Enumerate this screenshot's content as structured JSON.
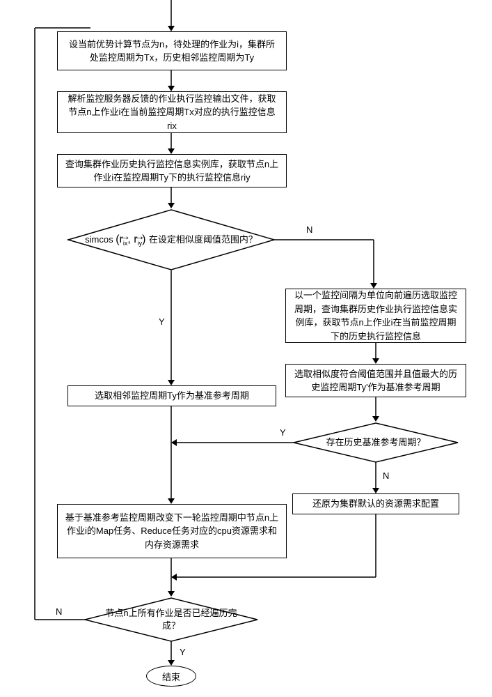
{
  "boxes": {
    "b1": "设当前优势计算节点为n，待处理的作业为i，集群所处监控周期为Tx，历史相邻监控周期为Ty",
    "b2": "解析监控服务器反馈的作业执行监控输出文件，获取节点n上作业i在当前监控周期Tx对应的执行监控信息rix",
    "b3": "查询集群作业历史执行监控信息实例库，获取节点n上作业i在监控周期Ty下的执行监控信息riy",
    "b4": "以一个监控间隔为单位向前遍历选取监控周期，查询集群历史作业执行监控信息实例库，获取节点n上作业i在当前监控周期下的历史执行监控信息",
    "b5": "选取相邻监控周期Ty作为基准参考周期",
    "b6": "选取相似度符合阈值范围并且值最大的历史监控周期Ty'作为基准参考周期",
    "b7": "基于基准参考监控周期改变下一轮监控周期中节点n上作业i的Map任务、Reduce任务对应的cpu资源需求和内存资源需求",
    "b8": "还原为集群默认的资源需求配置"
  },
  "diamonds": {
    "d1_prefix": "simcos",
    "d1_vec": "(r⃗ᵢₓ, r⃗ᵢᵧ)",
    "d1_text": "在设定相似度阈值范围内？",
    "d2": "存在历史基准参考周期？",
    "d3": "节点n上所有作业是否已经遍历完成？"
  },
  "terminal": {
    "end": "结束"
  },
  "labels": {
    "yes": "Y",
    "no": "N"
  }
}
